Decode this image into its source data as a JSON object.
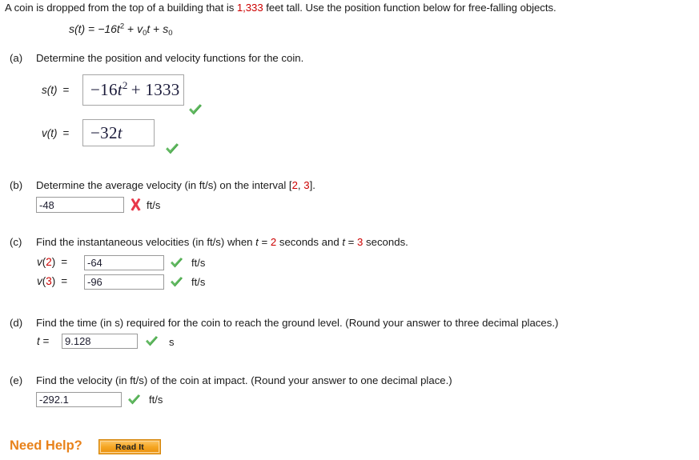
{
  "intro": {
    "text_before": "A coin is dropped from the top of a building that is ",
    "height_value": "1,333",
    "text_after": " feet tall. Use the position function below for free-falling objects."
  },
  "formula": {
    "lhs": "s(t)",
    "eq": " = ",
    "term1_coef": "−16t",
    "term1_exp": "2",
    "plus1": " + ",
    "term2_var": "v",
    "term2_sub": "0",
    "term2_t": "t",
    "plus2": " + ",
    "term3_var": "s",
    "term3_sub": "0"
  },
  "parts": {
    "a": {
      "letter": "(a)",
      "prompt": "Determine the position and velocity functions for the coin.",
      "rows": [
        {
          "label_fn": "s",
          "label_arg": "(t)",
          "label_eq": "=",
          "math_pre": "−16",
          "math_var": "t",
          "math_exp": "2",
          "math_post": "+ 1333",
          "mark": "check"
        },
        {
          "label_fn": "v",
          "label_arg": "(t)",
          "label_eq": "=",
          "math_pre": "−32",
          "math_var": "t",
          "math_exp": "",
          "math_post": "",
          "mark": "check"
        }
      ]
    },
    "b": {
      "letter": "(b)",
      "prompt_before": "Determine the average velocity (in ft/s) on the interval [",
      "interval_lo": "2",
      "prompt_mid": ", ",
      "interval_hi": "3",
      "prompt_after": "].",
      "value": "-48",
      "mark": "cross",
      "unit": "ft/s"
    },
    "c": {
      "letter": "(c)",
      "prompt_p1": "Find the instantaneous velocities (in ft/s) when ",
      "prompt_t1": "t",
      "prompt_p2": " = ",
      "t_value_1": "2",
      "prompt_p3": " seconds and ",
      "prompt_t2": "t",
      "prompt_p4": " = ",
      "t_value_2": "3",
      "prompt_p5": " seconds.",
      "rows": [
        {
          "label_fn": "v",
          "label_open": "(",
          "label_num": "2",
          "label_close": ")",
          "label_eq": "=",
          "value": "-64",
          "mark": "check",
          "unit": "ft/s"
        },
        {
          "label_fn": "v",
          "label_open": "(",
          "label_num": "3",
          "label_close": ")",
          "label_eq": "=",
          "value": "-96",
          "mark": "check",
          "unit": "ft/s"
        }
      ]
    },
    "d": {
      "letter": "(d)",
      "prompt": "Find the time (in s) required for the coin to reach the ground level. (Round your answer to three decimal places.)",
      "label_var": "t",
      "label_eq": " =",
      "value": "9.128",
      "mark": "check",
      "unit": "s"
    },
    "e": {
      "letter": "(e)",
      "prompt": "Find the velocity (in ft/s) of the coin at impact. (Round your answer to one decimal place.)",
      "value": "-292.1",
      "mark": "check",
      "unit": "ft/s"
    }
  },
  "help": {
    "label": "Need Help?",
    "button_label": "Read It"
  },
  "colors": {
    "red_value": "#cc0000",
    "check_green": "#3c9a3c",
    "cross_red": "#e8384a",
    "help_orange": "#e8821a",
    "button_orange": "#f5a623"
  }
}
